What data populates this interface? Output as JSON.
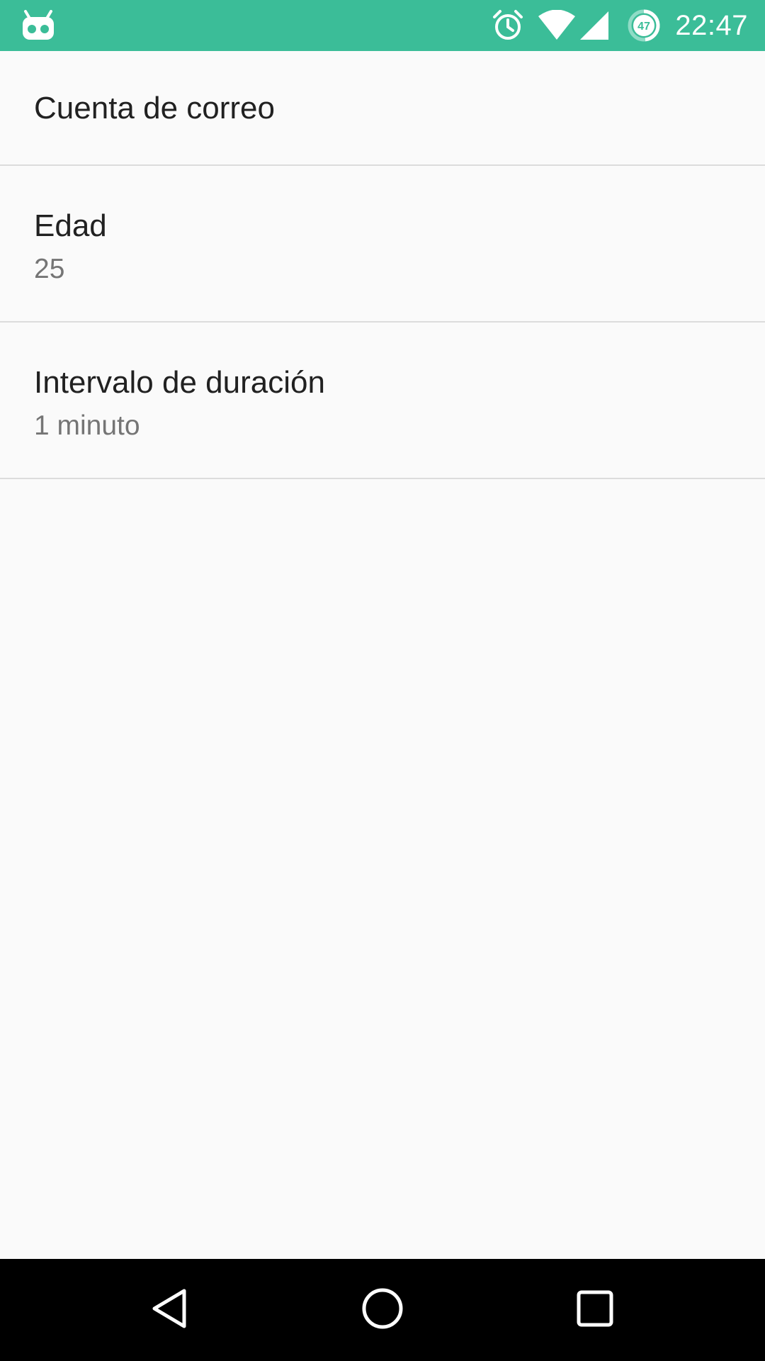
{
  "status_bar": {
    "time": "22:47",
    "battery_level": "47",
    "app_icon": "cyanogenmod-bot-icon",
    "icons": [
      "alarm-icon",
      "wifi-icon",
      "signal-icon",
      "battery-icon"
    ],
    "background_color": "#3bbd98"
  },
  "preferences": {
    "items": [
      {
        "title": "Cuenta de correo"
      },
      {
        "title": "Edad",
        "summary": "25"
      },
      {
        "title": "Intervalo de duración",
        "summary": "1 minuto"
      }
    ]
  },
  "nav_bar": {
    "buttons": [
      "back-icon",
      "home-icon",
      "recents-icon"
    ]
  }
}
